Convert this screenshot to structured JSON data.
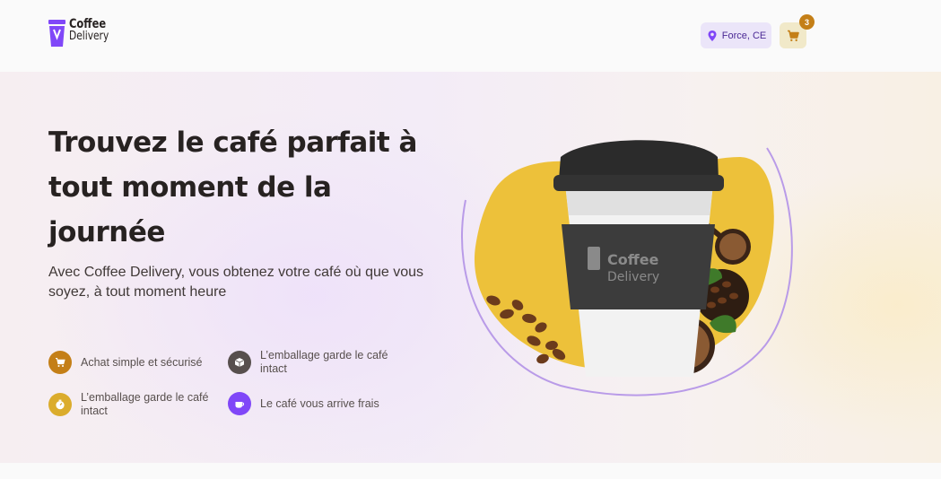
{
  "brand": {
    "line1": "Coffee",
    "line2": "Delivery"
  },
  "header": {
    "location": "Force, CE",
    "cart_count": "3"
  },
  "hero": {
    "title": "Trouvez le café parfait à tout moment de la journée",
    "subtitle": "Avec Coffee Delivery, vous obtenez votre café où que vous soyez, à tout moment heure",
    "cup_brand_line1": "Coffee",
    "cup_brand_line2": "Delivery"
  },
  "features": [
    {
      "label": "Achat simple et sécurisé",
      "icon": "cart-icon",
      "color": "#c47f17"
    },
    {
      "label": "L’emballage garde le café intact",
      "icon": "package-icon",
      "color": "#574f4d"
    },
    {
      "label": "L’emballage garde le café intact",
      "icon": "timer-icon",
      "color": "#dbac2c"
    },
    {
      "label": "Le café vous arrive frais",
      "icon": "coffee-icon",
      "color": "#8047f8"
    }
  ],
  "colors": {
    "purple": "#8047f8",
    "purple_light": "#ebe5f9",
    "yellow_dark": "#c47f17",
    "yellow": "#dbac2c",
    "yellow_light": "#f1e9c9",
    "title": "#272221"
  }
}
